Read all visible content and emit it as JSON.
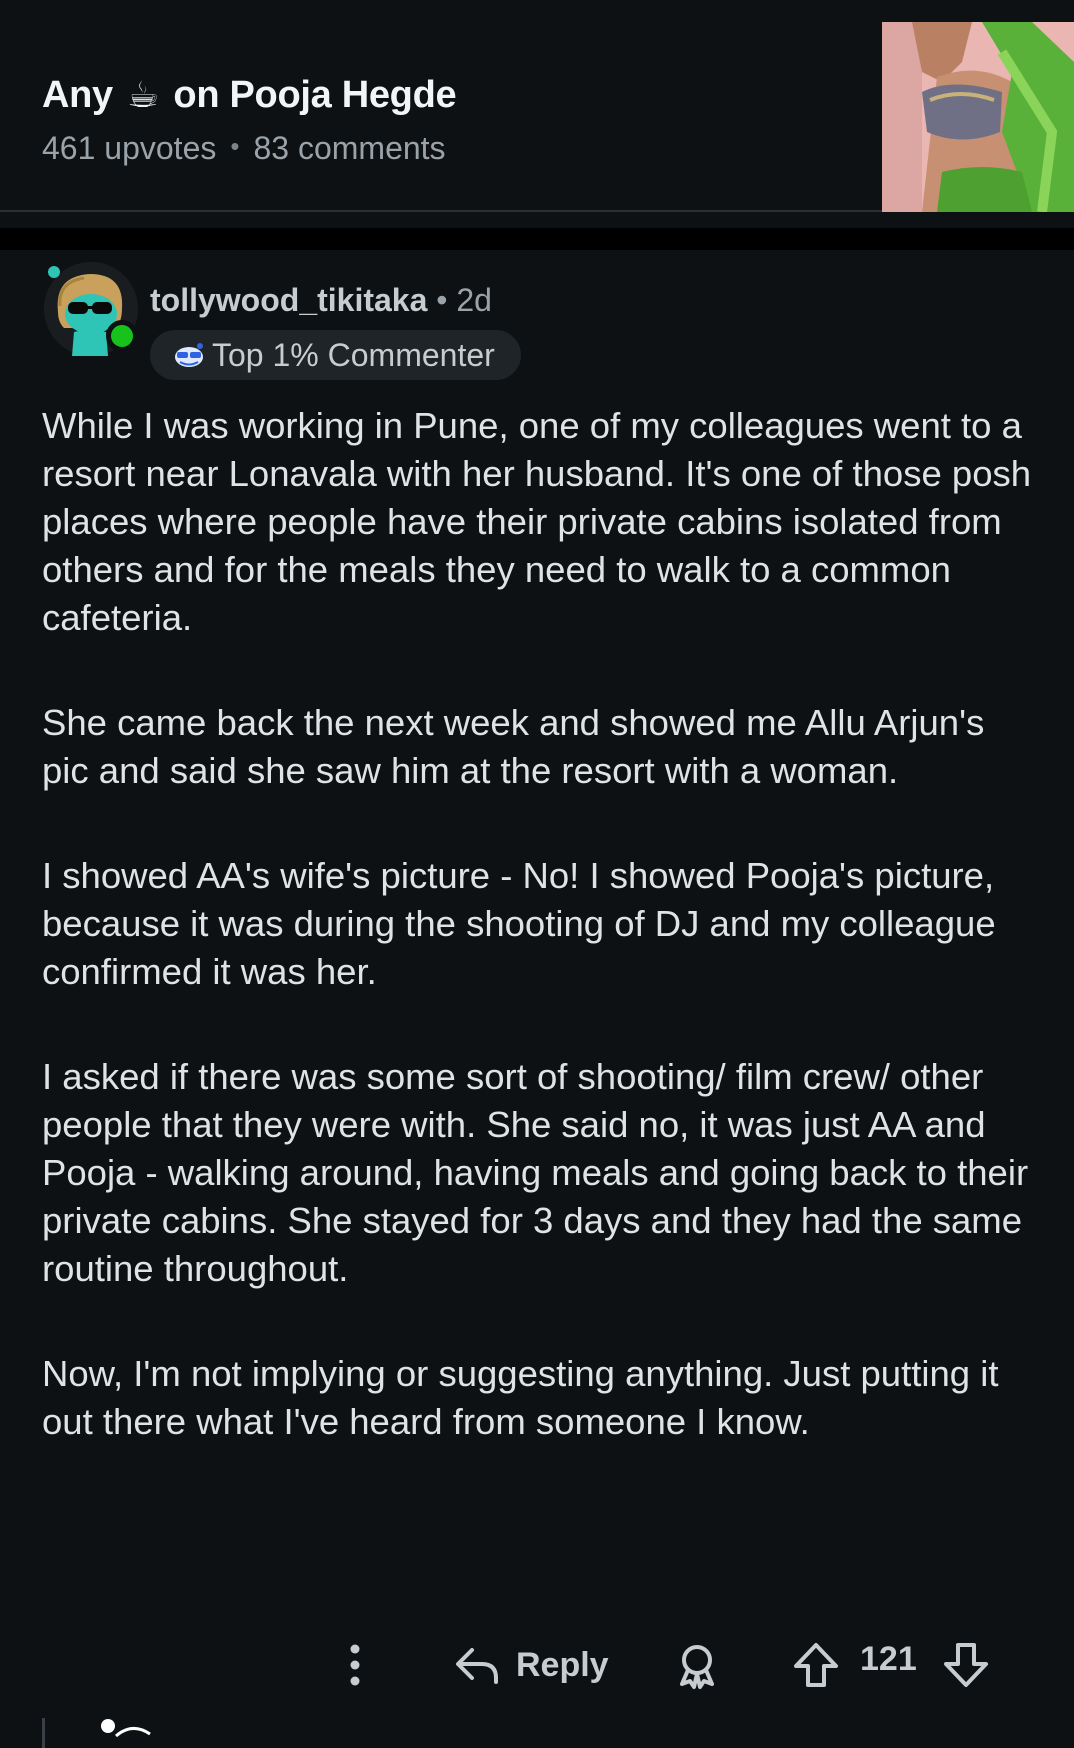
{
  "post": {
    "title_before": "Any",
    "title_after": "on Pooja Hegde",
    "upvotes": "461 upvotes",
    "comments": "83 comments"
  },
  "comment": {
    "username": "tollywood_tikitaka",
    "age": "• 2d",
    "flair": "Top 1% Commenter",
    "paragraphs": [
      "While I was working in Pune, one of my colleagues went to a resort near Lonavala with her husband. It's one of those posh places where people have their private cabins isolated from others and for the meals they need to walk to a common cafeteria.",
      "She came back the next week and showed me Allu Arjun's pic and said she saw him at the resort with a woman.",
      "I showed AA's wife's picture - No! I showed Pooja's picture, because it was during the shooting of DJ and my colleague confirmed it was her.",
      "I asked if there was some sort of shooting/ film crew/ other people that they were with. She said no, it was just AA and Pooja - walking around, having meals and going back to their private cabins. She stayed for 3 days and they had the same routine throughout.",
      "Now, I'm not implying or suggesting anything. Just putting it out there what I've heard from someone I know."
    ],
    "actions": {
      "reply": "Reply",
      "score": "121"
    }
  },
  "icons": {
    "title_emoji": "coffee-cup-icon",
    "more": "more-vertical-icon",
    "reply": "reply-arrow-icon",
    "award": "award-icon",
    "upvote": "upvote-arrow-icon",
    "downvote": "downvote-arrow-icon"
  },
  "colors": {
    "background": "#0e1113",
    "separator": "#000000",
    "text": "#dfe3e6",
    "meta": "#9aa3a9",
    "online": "#17c21d"
  }
}
